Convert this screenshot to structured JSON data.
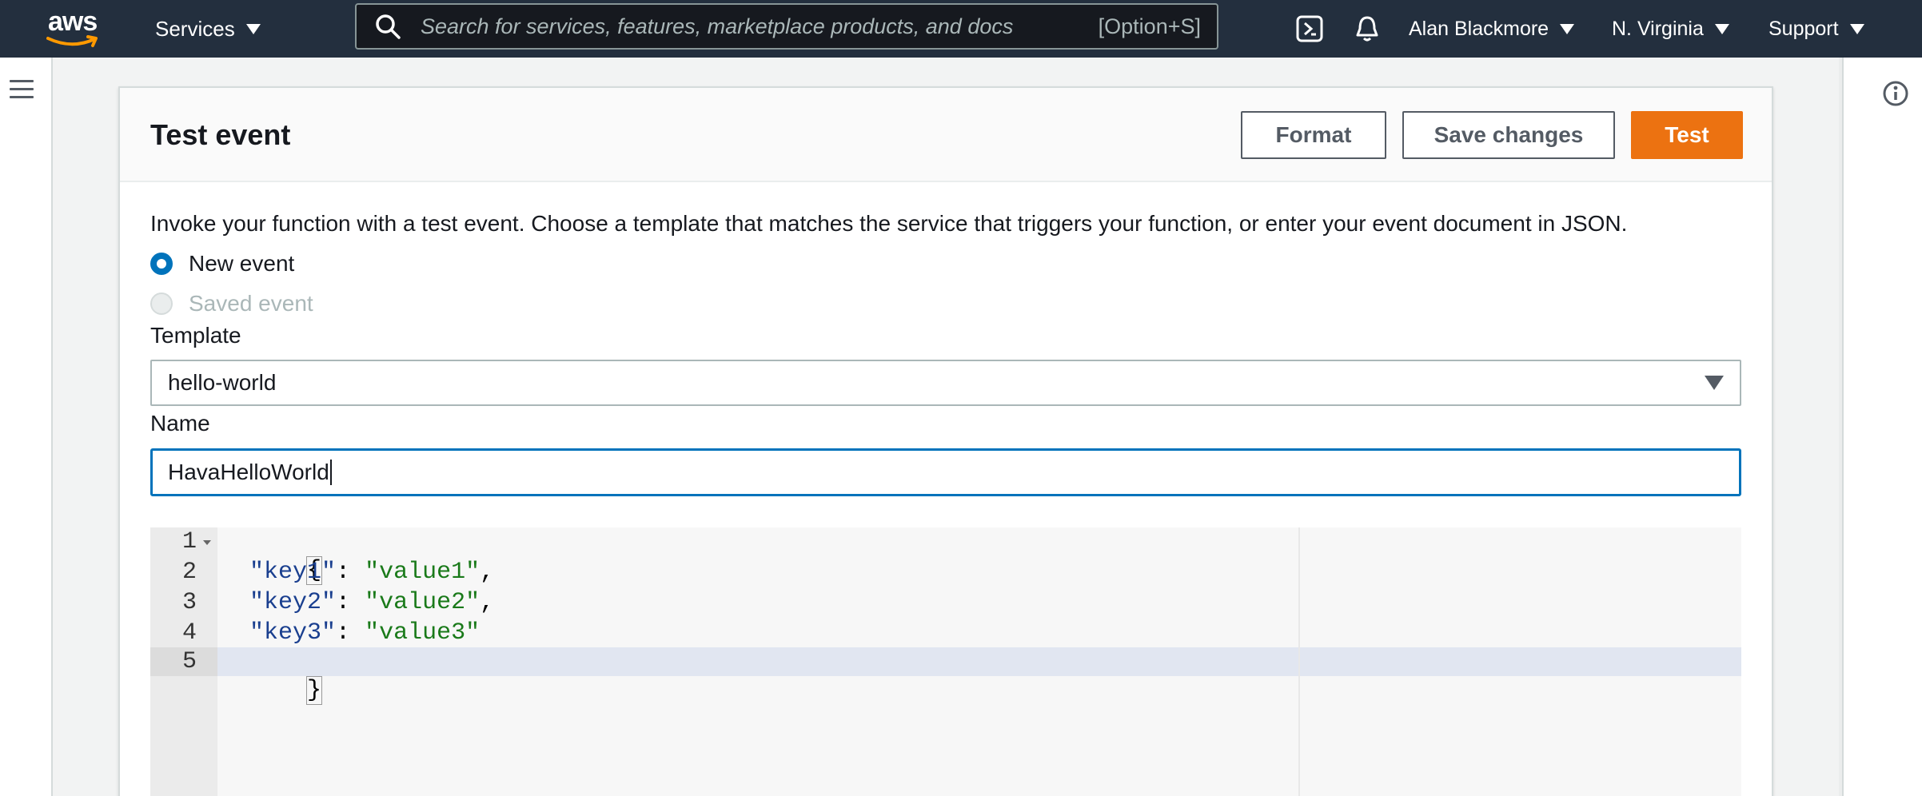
{
  "topnav": {
    "logo_text": "aws",
    "services_label": "Services",
    "search_placeholder": "Search for services, features, marketplace products, and docs",
    "search_shortcut": "[Option+S]",
    "user_label": "Alan Blackmore",
    "region_label": "N. Virginia",
    "support_label": "Support"
  },
  "panel": {
    "title": "Test event",
    "buttons": {
      "format": "Format",
      "save": "Save changes",
      "test": "Test"
    },
    "description": "Invoke your function with a test event. Choose a template that matches the service that triggers your function, or enter your event document in JSON.",
    "event_options": [
      {
        "label": "New event",
        "checked": true,
        "disabled": false
      },
      {
        "label": "Saved event",
        "checked": false,
        "disabled": true
      }
    ],
    "template_label": "Template",
    "template_value": "hello-world",
    "name_label": "Name",
    "name_value": "HavaHelloWorld"
  },
  "editor": {
    "line_numbers": [
      "1",
      "2",
      "3",
      "4",
      "5"
    ],
    "lines": [
      {
        "open": "{"
      },
      {
        "key": "\"key1\"",
        "sep": ": ",
        "value": "\"value1\"",
        "end": ","
      },
      {
        "key": "\"key2\"",
        "sep": ": ",
        "value": "\"value2\"",
        "end": ","
      },
      {
        "key": "\"key3\"",
        "sep": ": ",
        "value": "\"value3\"",
        "end": ""
      },
      {
        "close": "}"
      }
    ],
    "active_line": 5
  },
  "colors": {
    "nav_bg": "#232f3e",
    "accent_orange": "#ec7211",
    "focus_blue": "#0073bb"
  },
  "icons": [
    "aws-logo-icon",
    "chevron-down-icon",
    "search-icon",
    "cloudshell-icon",
    "bell-icon",
    "menu-icon",
    "info-icon"
  ]
}
